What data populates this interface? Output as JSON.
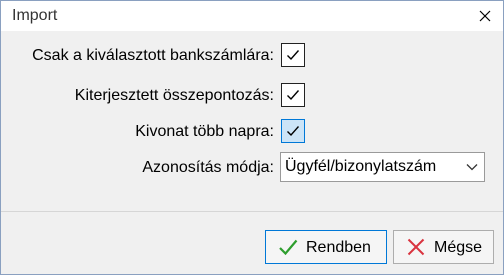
{
  "window": {
    "title": "Import"
  },
  "form": {
    "only_selected_account_label": "Csak a kiválasztott bankszámlára:",
    "only_selected_account_checked": true,
    "extended_summary_label": "Kiterjesztett összepontozás:",
    "extended_summary_checked": true,
    "multi_day_statement_label": "Kivonat több napra:",
    "multi_day_statement_checked": true,
    "identification_label": "Azonosítás módja:",
    "identification_value": "Ügyfél/bizonylatszám"
  },
  "buttons": {
    "ok_label": "Rendben",
    "cancel_label": "Mégse"
  },
  "icons": {
    "close": "close-icon",
    "check": "checkmark-icon",
    "dropdown": "chevron-down-icon",
    "ok": "green-check-icon",
    "cancel": "red-x-icon"
  },
  "colors": {
    "ok_icon": "#2e9e2e",
    "cancel_icon": "#d9333f",
    "focus_border": "#0078d7",
    "focus_fill": "#cce4f7"
  }
}
